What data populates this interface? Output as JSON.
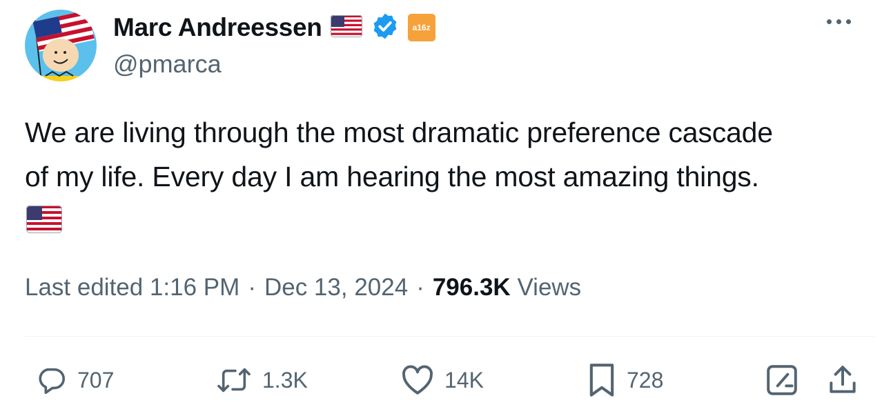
{
  "author": {
    "display_name": "Marc Andreessen",
    "handle": "@pmarca",
    "affiliate_badge": "a16z",
    "verified_icon": "verified-badge-icon",
    "name_emoji": "us-flag-icon",
    "verified_color": "#1d9bf0",
    "affiliate_color": "#f6a13a"
  },
  "tweet": {
    "text_lines": [
      "We are living through the most dramatic preference cascade",
      "of my life. Every day I am hearing the most amazing things."
    ],
    "trailing_emoji": "us-flag-icon"
  },
  "meta": {
    "edited_label": "Last edited 1:16 PM",
    "separator": "·",
    "date": "Dec 13, 2024",
    "views_count": "796.3K",
    "views_label": "Views"
  },
  "actions": {
    "replies": "707",
    "reposts": "1.3K",
    "likes": "14K",
    "bookmarks": "728"
  },
  "colors": {
    "text": "#0f1419",
    "secondary": "#536471",
    "divider": "#eff3f4"
  }
}
